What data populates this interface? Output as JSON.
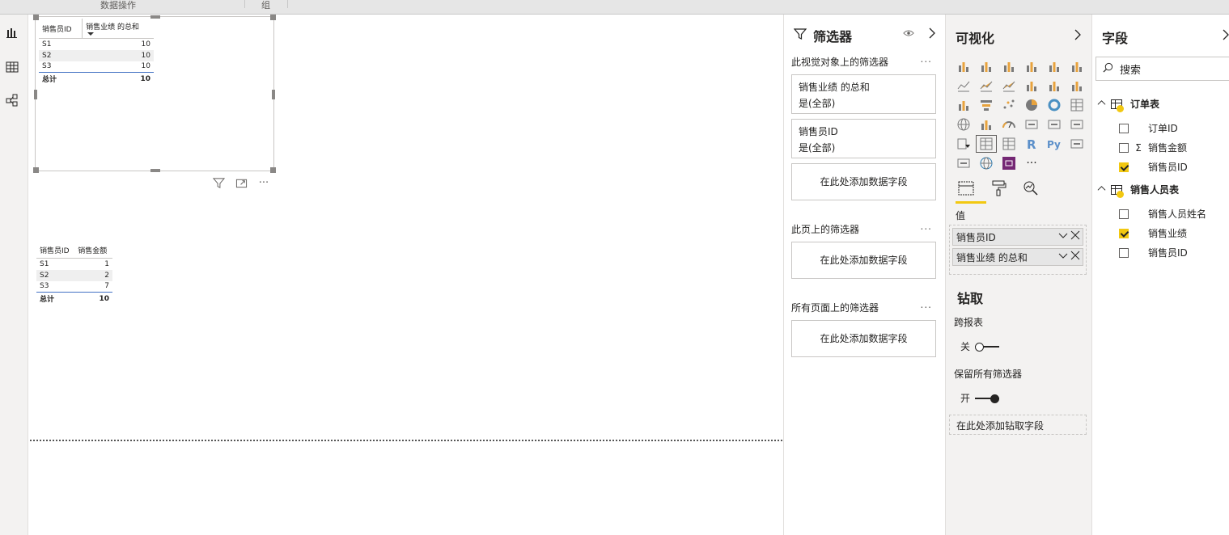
{
  "ribbon": {
    "group1": "数据操作",
    "group2": "组"
  },
  "visual1": {
    "headers": [
      "销售员ID",
      "销售业绩 的总和"
    ],
    "rows": [
      [
        "S1",
        "10"
      ],
      [
        "S2",
        "10"
      ],
      [
        "S3",
        "10"
      ]
    ],
    "total": [
      "总计",
      "10"
    ]
  },
  "visual2": {
    "headers": [
      "销售员ID",
      "销售金额"
    ],
    "rows": [
      [
        "S1",
        "1"
      ],
      [
        "S2",
        "2"
      ],
      [
        "S3",
        "7"
      ]
    ],
    "total": [
      "总计",
      "10"
    ]
  },
  "filters": {
    "title": "筛选器",
    "visual_section": "此视觉对象上的筛选器",
    "cards": [
      {
        "name": "销售业绩 的总和",
        "state": "是(全部)"
      },
      {
        "name": "销售员ID",
        "state": "是(全部)"
      }
    ],
    "add_field": "在此处添加数据字段",
    "page_section": "此页上的筛选器",
    "all_pages_section": "所有页面上的筛选器",
    "more": "..."
  },
  "viz": {
    "title": "可视化",
    "more": "···",
    "values_label": "值",
    "values": [
      "销售员ID",
      "销售业绩 的总和"
    ],
    "drill_title": "钻取",
    "cross_report": "跨报表",
    "cross_report_state": "关",
    "keep_filters": "保留所有筛选器",
    "keep_filters_state": "开",
    "drill_placeholder": "在此处添加钻取字段"
  },
  "fields": {
    "title": "字段",
    "search_placeholder": "搜索",
    "tables": [
      {
        "name": "订单表",
        "fields": [
          {
            "name": "订单ID",
            "checked": false,
            "sigma": false
          },
          {
            "name": "销售金额",
            "checked": false,
            "sigma": true
          },
          {
            "name": "销售员ID",
            "checked": true,
            "sigma": false
          }
        ]
      },
      {
        "name": "销售人员表",
        "fields": [
          {
            "name": "销售人员姓名",
            "checked": false,
            "sigma": false
          },
          {
            "name": "销售业绩",
            "checked": true,
            "sigma": false
          },
          {
            "name": "销售员ID",
            "checked": false,
            "sigma": false
          }
        ]
      }
    ]
  },
  "colors": {
    "accent": "#f2c811",
    "total_border": "#4472c4",
    "pane_bg": "#f3f2f1"
  }
}
